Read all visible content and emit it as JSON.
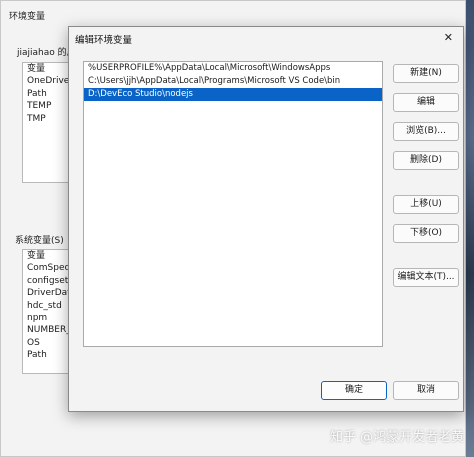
{
  "background_window": {
    "title": "环境变量",
    "user_vars_label": "jiajiahao 的用",
    "user_header": "变量",
    "user_vars": [
      "OneDrive",
      "Path",
      "TEMP",
      "TMP"
    ],
    "system_vars_label": "系统变量(S)",
    "system_header": "变量",
    "system_vars": [
      "ComSpec",
      "configsetr",
      "DriverData",
      "hdc_std",
      "npm",
      "NUMBER_",
      "OS",
      "Path"
    ]
  },
  "dialog": {
    "title": "编辑环境变量",
    "close_glyph": "✕",
    "paths": [
      "%USERPROFILE%\\AppData\\Local\\Microsoft\\WindowsApps",
      "C:\\Users\\jjh\\AppData\\Local\\Programs\\Microsoft VS Code\\bin",
      "D:\\DevEco Studio\\nodejs"
    ],
    "selected_index": 2,
    "buttons": {
      "new": "新建(N)",
      "edit": "编辑",
      "browse": "浏览(B)...",
      "delete": "删除(D)",
      "move_up": "上移(U)",
      "move_down": "下移(O)",
      "edit_text": "编辑文本(T)...",
      "ok": "确定",
      "cancel": "取消"
    }
  },
  "watermark": "知乎 @鸿蒙开发者老黄",
  "colors": {
    "selection": "#0a64c8",
    "dialog_bg": "#f3f3f3"
  }
}
